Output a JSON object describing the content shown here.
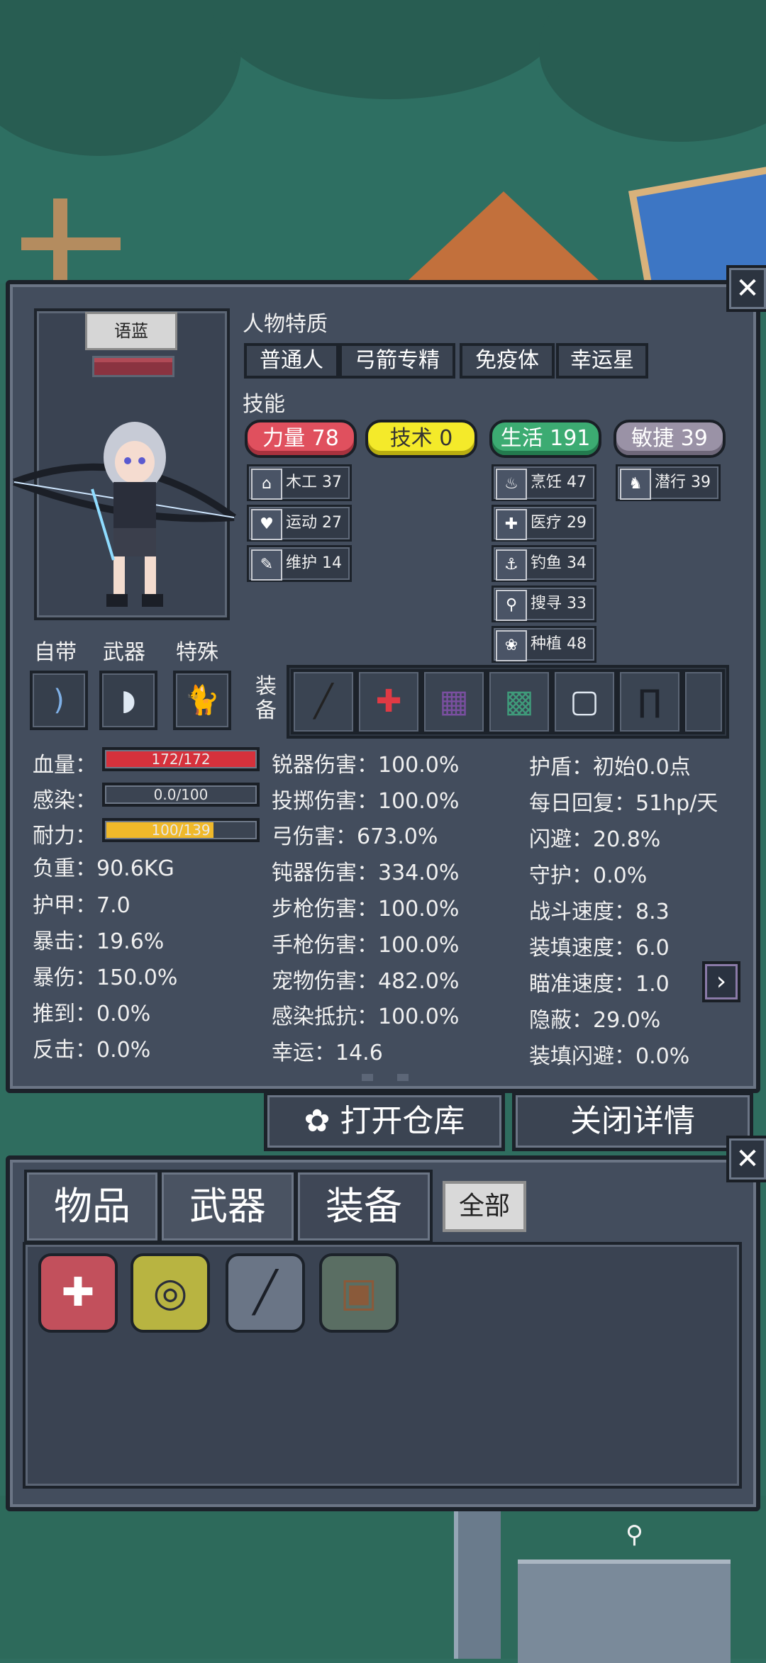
{
  "character": {
    "name": "语蓝",
    "traits_label": "人物特质",
    "traits": [
      "普通人",
      "弓箭专精",
      "免疫体",
      "幸运星"
    ],
    "skills_label": "技能",
    "attributes": [
      {
        "name": "力量",
        "value": 78,
        "text": "力量 78",
        "color": "#e0505e"
      },
      {
        "name": "技术",
        "value": 0,
        "text": "技术 0",
        "color": "#f4ea2a"
      },
      {
        "name": "生活",
        "value": 191,
        "text": "生活 191",
        "color": "#3cab72"
      },
      {
        "name": "敏捷",
        "value": 39,
        "text": "敏捷 39",
        "color": "#9a92a6"
      }
    ],
    "skills": {
      "strength": [
        {
          "icon": "house-icon",
          "glyph": "⌂",
          "text": "木工 37"
        },
        {
          "icon": "heart-icon",
          "glyph": "♥",
          "text": "运动 27"
        },
        {
          "icon": "wrench-icon",
          "glyph": "✎",
          "text": "维护 14"
        }
      ],
      "life": [
        {
          "icon": "pot-icon",
          "glyph": "♨",
          "text": "烹饪 47"
        },
        {
          "icon": "medkit-icon",
          "glyph": "✚",
          "text": "医疗 29"
        },
        {
          "icon": "fishing-icon",
          "glyph": "⚓",
          "text": "钓鱼 34"
        },
        {
          "icon": "magnifier-icon",
          "glyph": "⚲",
          "text": "搜寻 33"
        },
        {
          "icon": "plant-icon",
          "glyph": "❀",
          "text": "种植 48"
        }
      ],
      "agility": [
        {
          "icon": "sneak-icon",
          "glyph": "♞",
          "text": "潜行 39"
        }
      ]
    },
    "slot_labels": [
      "自带",
      "武器",
      "特殊"
    ],
    "equip_label": "装备"
  },
  "stats": {
    "bars": [
      {
        "label": "血量：",
        "text": "172/172",
        "fraction": 1.0,
        "color": "#d6313c"
      },
      {
        "label": "感染：",
        "text": "0.0/100",
        "fraction": 0.0,
        "color": "#6a7486"
      },
      {
        "label": "耐力：",
        "text": "100/139",
        "fraction": 0.72,
        "color": "#f0b92a"
      }
    ],
    "left": [
      "负重：90.6KG",
      "护甲：7.0",
      "暴击：19.6%",
      "暴伤：150.0%",
      "推到：0.0%",
      "反击：0.0%"
    ],
    "middle": [
      "锐器伤害：100.0%",
      "投掷伤害：100.0%",
      "弓伤害：673.0%",
      "钝器伤害：334.0%",
      "步枪伤害：100.0%",
      "手枪伤害：100.0%",
      "宠物伤害：482.0%",
      "感染抵抗：100.0%",
      "幸运：14.6"
    ],
    "right": [
      "护盾：初始0.0点",
      "每日回复：51hp/天",
      "闪避：20.8%",
      "守护：0.0%",
      "战斗速度：8.3",
      "装填速度：6.0",
      "瞄准速度：1.0",
      "隐蔽：29.0%",
      "装填闪避：0.0%"
    ]
  },
  "buttons": {
    "close": "✕",
    "open_storage": "打开仓库",
    "close_details": "关闭详情",
    "next": "›"
  },
  "inventory": {
    "tabs": [
      "物品",
      "武器",
      "装备"
    ],
    "filter_all": "全部",
    "items": [
      {
        "icon": "medkit-item-icon",
        "glyph": "✚",
        "bg": "#c2505c"
      },
      {
        "icon": "goggles-item-icon",
        "glyph": "◎",
        "bg": "#b8b441"
      },
      {
        "icon": "flashlight-item-icon",
        "glyph": "╱",
        "bg": "#6a7586"
      },
      {
        "icon": "backpack-item-icon",
        "glyph": "▣",
        "bg": "#5a6e63"
      }
    ]
  }
}
